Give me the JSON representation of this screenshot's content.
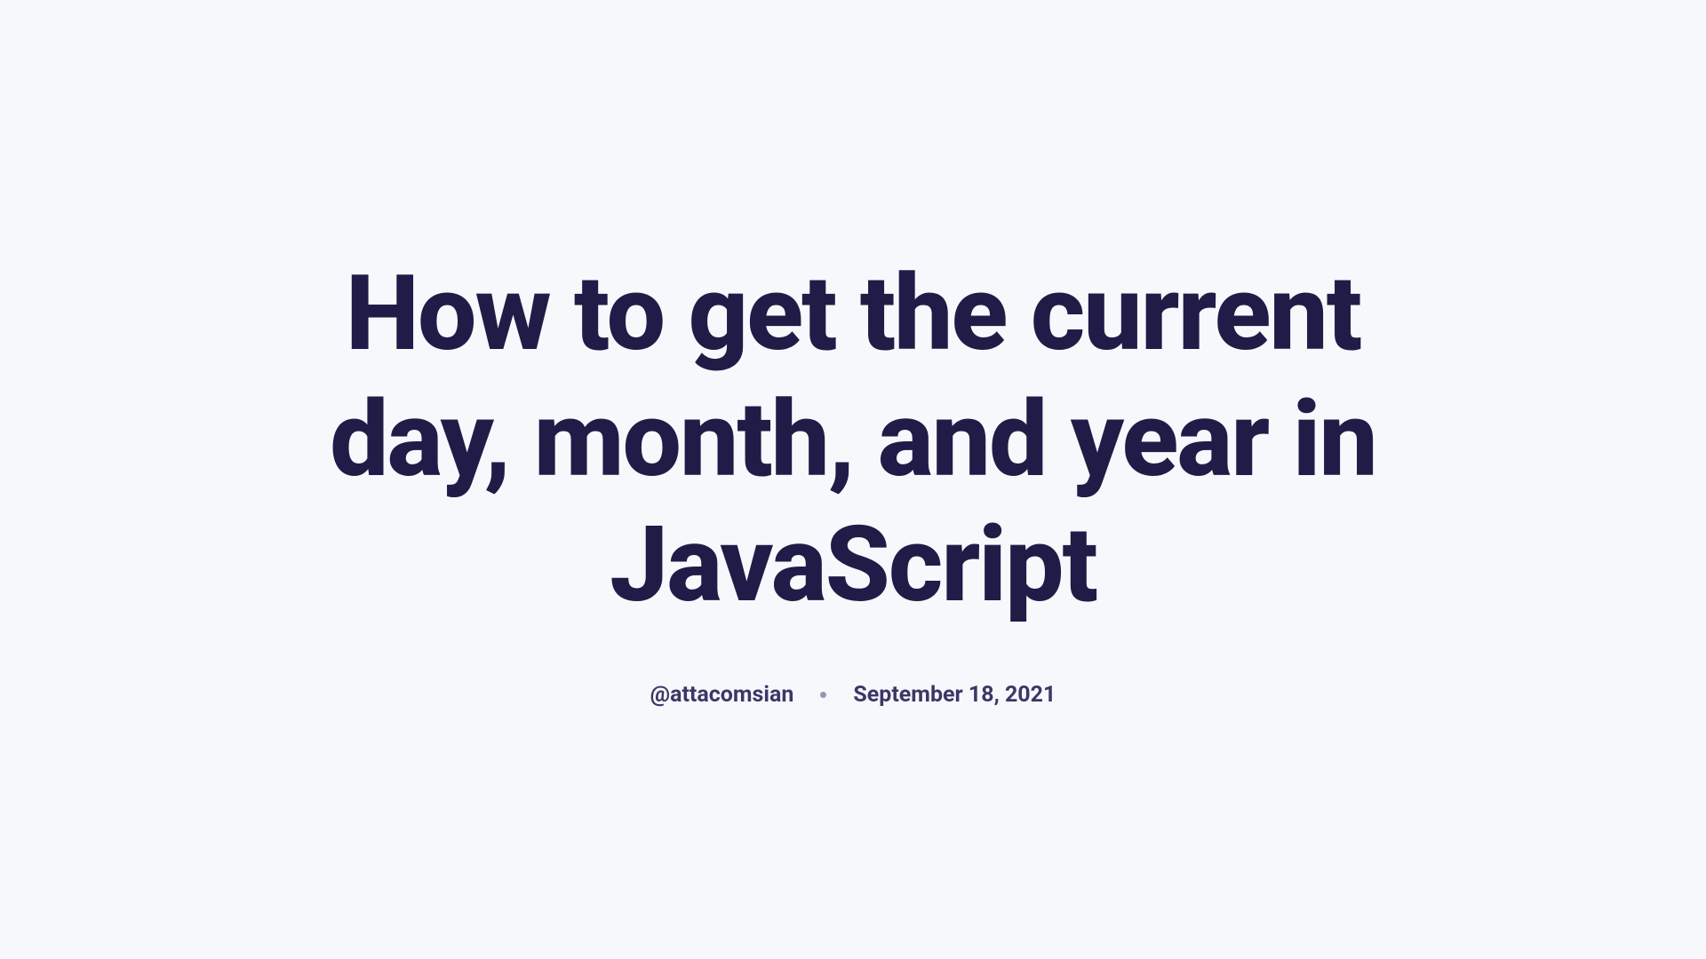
{
  "article": {
    "title": "How to get the current day, month, and year in JavaScript",
    "author": "@attacomsian",
    "date": "September 18, 2021"
  }
}
